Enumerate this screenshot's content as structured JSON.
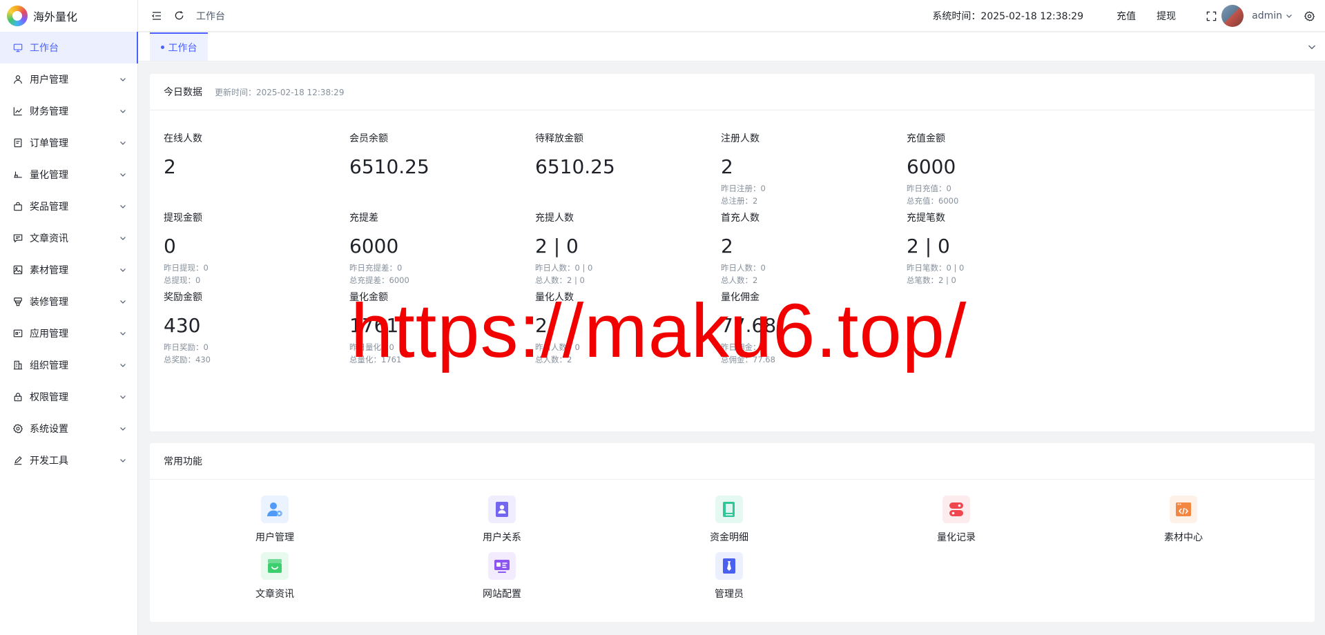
{
  "app": {
    "name": "海外量化"
  },
  "sidebar": {
    "items": [
      {
        "label": "工作台",
        "icon": "monitor-icon",
        "active": true
      },
      {
        "label": "用户管理",
        "icon": "user-icon"
      },
      {
        "label": "财务管理",
        "icon": "chart-icon"
      },
      {
        "label": "订单管理",
        "icon": "document-icon"
      },
      {
        "label": "量化管理",
        "icon": "strategy-icon"
      },
      {
        "label": "奖品管理",
        "icon": "bag-icon"
      },
      {
        "label": "文章资讯",
        "icon": "message-icon"
      },
      {
        "label": "素材管理",
        "icon": "image-icon"
      },
      {
        "label": "装修管理",
        "icon": "brush-icon"
      },
      {
        "label": "应用管理",
        "icon": "app-icon"
      },
      {
        "label": "组织管理",
        "icon": "building-icon"
      },
      {
        "label": "权限管理",
        "icon": "lock-icon"
      },
      {
        "label": "系统设置",
        "icon": "gear-icon"
      },
      {
        "label": "开发工具",
        "icon": "pen-icon"
      }
    ]
  },
  "header": {
    "breadcrumb": "工作台",
    "system_time": "系统时间：2025-02-18 12:38:29",
    "recharge": "充值",
    "withdraw": "提现",
    "username": "admin"
  },
  "tabs": [
    {
      "label": "工作台",
      "active": true
    }
  ],
  "today": {
    "title": "今日数据",
    "update_time": "更新时间：2025-02-18 12:38:29",
    "stats": [
      {
        "label": "在线人数",
        "value": "2",
        "sub": []
      },
      {
        "label": "会员余额",
        "value": "6510.25",
        "sub": []
      },
      {
        "label": "待释放金额",
        "value": "6510.25",
        "sub": []
      },
      {
        "label": "注册人数",
        "value": "2",
        "sub": [
          "昨日注册：0",
          "总注册：2"
        ]
      },
      {
        "label": "充值金额",
        "value": "6000",
        "sub": [
          "昨日充值：0",
          "总充值：6000"
        ]
      },
      {
        "label": "提现金额",
        "value": "0",
        "sub": [
          "昨日提现：0",
          "总提现：0"
        ]
      },
      {
        "label": "充提差",
        "value": "6000",
        "sub": [
          "昨日充提差：0",
          "总充提差：6000"
        ]
      },
      {
        "label": "充提人数",
        "value": "2 | 0",
        "sub": [
          "昨日人数：0 | 0",
          "总人数：2 | 0"
        ]
      },
      {
        "label": "首充人数",
        "value": "2",
        "sub": [
          "昨日人数：0",
          "总人数：2"
        ]
      },
      {
        "label": "充提笔数",
        "value": "2 | 0",
        "sub": [
          "昨日笔数：0 | 0",
          "总笔数：2 | 0"
        ]
      },
      {
        "label": "奖励金额",
        "value": "430",
        "sub": [
          "昨日奖励：0",
          "总奖励：430"
        ]
      },
      {
        "label": "量化金额",
        "value": "1761",
        "sub": [
          "昨日量化：0",
          "总量化：1761"
        ]
      },
      {
        "label": "量化人数",
        "value": "2",
        "sub": [
          "昨日人数：0",
          "总人数：2"
        ]
      },
      {
        "label": "量化佣金",
        "value": "77.68",
        "sub": [
          "昨日佣金：0",
          "总佣金：77.68"
        ]
      }
    ]
  },
  "functions": {
    "title": "常用功能",
    "items": [
      {
        "label": "用户管理",
        "icon": "user-settings-icon",
        "color": "#4f9bf7",
        "bg": "#eaf3ff"
      },
      {
        "label": "用户关系",
        "icon": "contact-book-icon",
        "color": "#7566f0",
        "bg": "#efedfe"
      },
      {
        "label": "资金明细",
        "icon": "ledger-icon",
        "color": "#2fc79a",
        "bg": "#e6f8f2"
      },
      {
        "label": "量化记录",
        "icon": "server-icon",
        "color": "#f0474f",
        "bg": "#fdecee"
      },
      {
        "label": "素材中心",
        "icon": "code-window-icon",
        "color": "#f38742",
        "bg": "#fef1e8"
      },
      {
        "label": "文章资讯",
        "icon": "inbox-icon",
        "color": "#3ccf6e",
        "bg": "#e8f9ee"
      },
      {
        "label": "网站配置",
        "icon": "id-card-icon",
        "color": "#8a55f0",
        "bg": "#f2ecfe"
      },
      {
        "label": "管理员",
        "icon": "tie-icon",
        "color": "#4960f0",
        "bg": "#eceffe"
      }
    ]
  },
  "watermark": "https://maku6.top/",
  "colors": {
    "accent": "#4b61ff",
    "watermark": "#f20000"
  }
}
